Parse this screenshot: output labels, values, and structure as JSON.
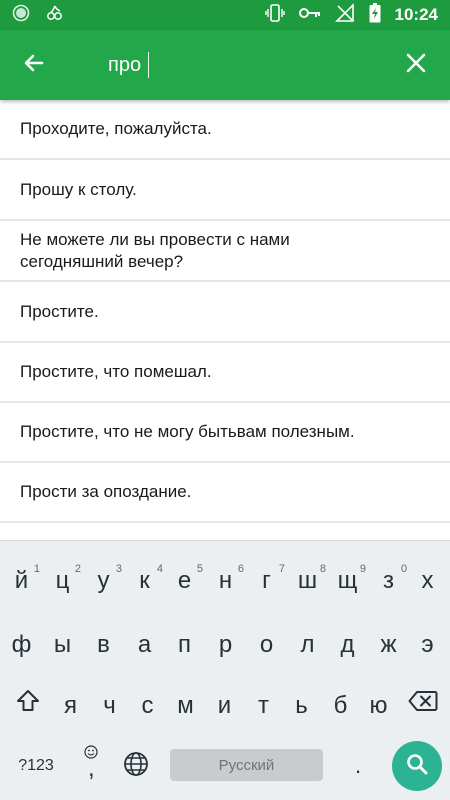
{
  "status_bar": {
    "time": "10:24",
    "left_icons": [
      "app-circle-icon",
      "cherry-icon"
    ],
    "right_icons": [
      "vibrate-icon",
      "key-icon",
      "signal-off-icon",
      "battery-charging-icon"
    ]
  },
  "search": {
    "query": "про",
    "back_icon": "arrow-left-icon",
    "clear_icon": "close-icon"
  },
  "results": [
    "Проходите, пожалуйста.",
    "Прошу к столу.",
    "Не можете ли вы провести с нами сегодняшний вечер?",
    "Простите.",
    "Простите, что помешал.",
    "Простите, что не могу бытьвам полезным.",
    "Прости за опоздание."
  ],
  "keyboard": {
    "row1": [
      {
        "letter": "й",
        "hint": "1"
      },
      {
        "letter": "ц",
        "hint": "2"
      },
      {
        "letter": "у",
        "hint": "3"
      },
      {
        "letter": "к",
        "hint": "4"
      },
      {
        "letter": "е",
        "hint": "5"
      },
      {
        "letter": "н",
        "hint": "6"
      },
      {
        "letter": "г",
        "hint": "7"
      },
      {
        "letter": "ш",
        "hint": "8"
      },
      {
        "letter": "щ",
        "hint": "9"
      },
      {
        "letter": "з",
        "hint": "0"
      },
      {
        "letter": "х",
        "hint": ""
      }
    ],
    "row2": [
      "ф",
      "ы",
      "в",
      "а",
      "п",
      "р",
      "о",
      "л",
      "д",
      "ж",
      "э"
    ],
    "row3": [
      "я",
      "ч",
      "с",
      "м",
      "и",
      "т",
      "ь",
      "б",
      "ю"
    ],
    "symbols_label": "?123",
    "comma_label": ",",
    "space_label": "Русский",
    "period_label": ".",
    "colors": {
      "background": "#eceff1",
      "action": "#2bb394",
      "app_bar": "#22a84a",
      "status_bar": "#1e9b3f"
    }
  }
}
